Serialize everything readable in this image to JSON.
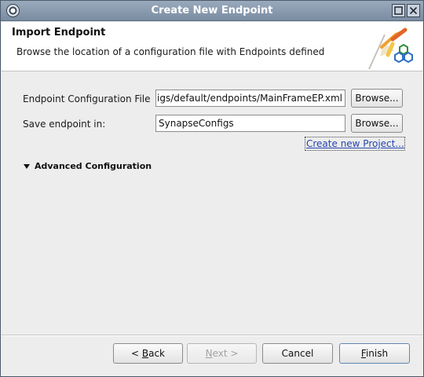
{
  "window": {
    "title": "Create New Endpoint"
  },
  "header": {
    "title": "Import Endpoint",
    "description": "Browse the location of a configuration file with Endpoints defined"
  },
  "form": {
    "config_file": {
      "label": "Endpoint Configuration File",
      "value": "igs/default/endpoints/MainFrameEP.xml",
      "browse_label": "Browse..."
    },
    "save_in": {
      "label": "Save endpoint in:",
      "value": "SynapseConfigs",
      "browse_label": "Browse..."
    },
    "create_project_link": "Create new Project...",
    "advanced_label": "Advanced Configuration"
  },
  "buttons": {
    "back": {
      "prefix": "< ",
      "mnemonic": "B",
      "rest": "ack"
    },
    "next": {
      "mnemonic": "N",
      "rest": "ext >"
    },
    "cancel": "Cancel",
    "finish": {
      "mnemonic": "F",
      "rest": "inish"
    }
  },
  "colors": {
    "link": "#2444b0",
    "titlebar": "#8a9bb0"
  }
}
